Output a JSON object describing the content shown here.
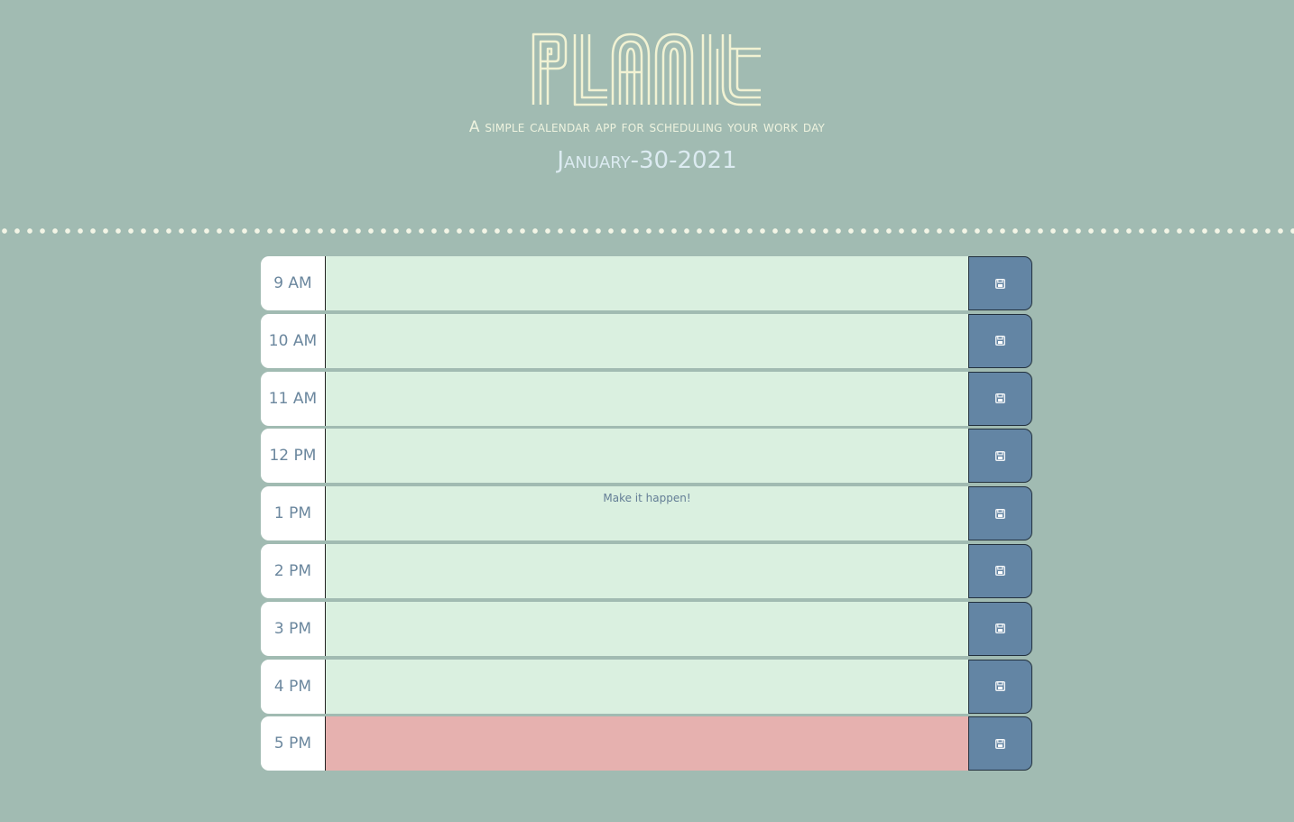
{
  "header": {
    "logo_text": "PLANIT",
    "tagline": "A simple calendar app for scheduling your work day",
    "date": "January-30-2021"
  },
  "colors": {
    "background": "#a1bbb2",
    "task_default": "#daf0e0",
    "task_past": "#e6b1af",
    "save_button": "#6385a4",
    "hour_text": "#6b879e",
    "logo": "#f1f2d3"
  },
  "rows": [
    {
      "hour": "9 AM",
      "task": "",
      "icon": "save-icon"
    },
    {
      "hour": "10 AM",
      "task": "",
      "icon": "save-icon"
    },
    {
      "hour": "11 AM",
      "task": "",
      "icon": "save-icon"
    },
    {
      "hour": "12 PM",
      "task": "",
      "icon": "save-icon"
    },
    {
      "hour": "1 PM",
      "task": "Make it happen!",
      "icon": "save-icon"
    },
    {
      "hour": "2 PM",
      "task": "",
      "icon": "save-icon"
    },
    {
      "hour": "3 PM",
      "task": "",
      "icon": "save-icon"
    },
    {
      "hour": "4 PM",
      "task": "",
      "icon": "save-icon"
    },
    {
      "hour": "5 PM",
      "task": "",
      "icon": "save-icon",
      "status": "past-due"
    }
  ]
}
